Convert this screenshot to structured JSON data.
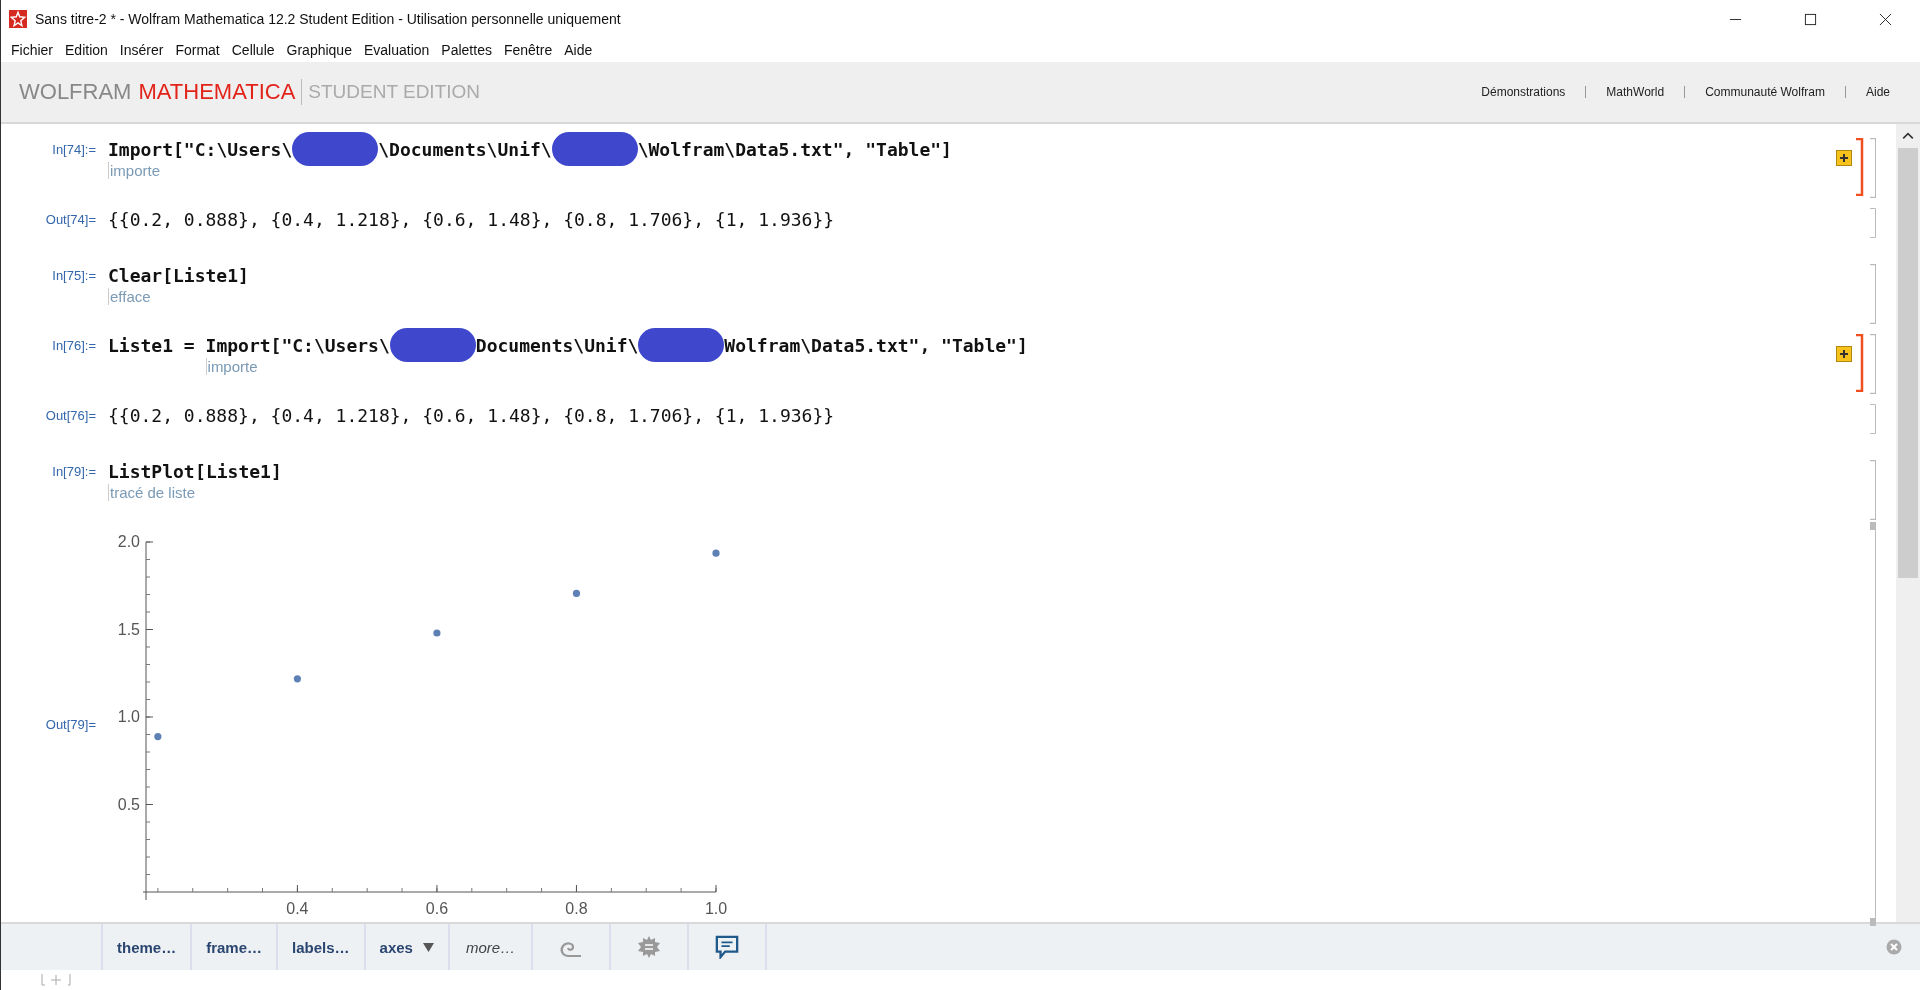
{
  "window": {
    "title": "Sans titre-2 * - Wolfram Mathematica 12.2 Student Edition - Utilisation personnelle uniquement"
  },
  "menu": [
    "Fichier",
    "Edition",
    "Insérer",
    "Format",
    "Cellule",
    "Graphique",
    "Evaluation",
    "Palettes",
    "Fenêtre",
    "Aide"
  ],
  "header": {
    "brand": "WOLFRAM",
    "product": "MATHEMATICA",
    "edition": "STUDENT EDITION",
    "links": [
      "Démonstrations",
      "MathWorld",
      "Communauté Wolfram",
      "Aide"
    ]
  },
  "cells": [
    {
      "kind": "input",
      "label": "In[74]:=",
      "expandable": true,
      "segments": [
        {
          "kind": "text",
          "text": "Import",
          "hint": "importe"
        },
        {
          "kind": "text",
          "text": "[\"C:\\Users\\"
        },
        {
          "kind": "redacted"
        },
        {
          "kind": "text",
          "text": "\\Documents\\Unif\\"
        },
        {
          "kind": "redacted"
        },
        {
          "kind": "text",
          "text": "\\Wolfram\\Data5.txt\", \"Table\"]"
        }
      ]
    },
    {
      "kind": "output",
      "label": "Out[74]=",
      "text": "{{0.2, 0.888}, {0.4, 1.218}, {0.6, 1.48}, {0.8, 1.706}, {1, 1.936}}"
    },
    {
      "kind": "input",
      "label": "In[75]:=",
      "expandable": false,
      "segments": [
        {
          "kind": "text",
          "text": "Clear",
          "hint": "efface"
        },
        {
          "kind": "text",
          "text": "[Liste1]"
        }
      ]
    },
    {
      "kind": "input",
      "label": "In[76]:=",
      "expandable": true,
      "segments": [
        {
          "kind": "text",
          "text": "Liste1 = "
        },
        {
          "kind": "text",
          "text": "Import",
          "hint": "importe"
        },
        {
          "kind": "text",
          "text": "[\"C:\\Users\\"
        },
        {
          "kind": "redacted"
        },
        {
          "kind": "text",
          "text": "Documents\\Unif\\"
        },
        {
          "kind": "redacted"
        },
        {
          "kind": "text",
          "text": "Wolfram\\Data5.txt\", \"Table\"]"
        }
      ]
    },
    {
      "kind": "output",
      "label": "Out[76]=",
      "text": "{{0.2, 0.888}, {0.4, 1.218}, {0.6, 1.48}, {0.8, 1.706}, {1, 1.936}}"
    },
    {
      "kind": "input",
      "label": "In[79]:=",
      "expandable": false,
      "segments": [
        {
          "kind": "text",
          "text": "ListPlot",
          "hint": "tracé de liste"
        },
        {
          "kind": "text",
          "text": "[Liste1]"
        }
      ]
    },
    {
      "kind": "plot",
      "label": "Out[79]=",
      "chart_data": {
        "type": "scatter",
        "x": [
          0.2,
          0.4,
          0.6,
          0.8,
          1
        ],
        "series": [
          {
            "color": "#5e81b5",
            "values": [
              0.888,
              1.218,
              1.48,
              1.706,
              1.936
            ]
          }
        ],
        "xlim": [
          0.183,
          1.0
        ],
        "ylim": [
          0,
          2.0
        ],
        "xticks": [
          {
            "value": 0.4,
            "label": "0.4"
          },
          {
            "value": 0.6,
            "label": "0.6"
          },
          {
            "value": 0.8,
            "label": "0.8"
          },
          {
            "value": 1.0,
            "label": "1.0"
          }
        ],
        "yticks": [
          {
            "value": 0.5,
            "label": "0.5"
          },
          {
            "value": 1.0,
            "label": "1.0"
          },
          {
            "value": 1.5,
            "label": "1.5"
          },
          {
            "value": 2.0,
            "label": "2.0"
          }
        ]
      }
    }
  ],
  "plot_toolbar": [
    {
      "kind": "text",
      "label": "theme…"
    },
    {
      "kind": "text",
      "label": "frame…"
    },
    {
      "kind": "text",
      "label": "labels…"
    },
    {
      "kind": "menu",
      "label": "axes"
    },
    {
      "kind": "italic",
      "label": "more…"
    }
  ]
}
